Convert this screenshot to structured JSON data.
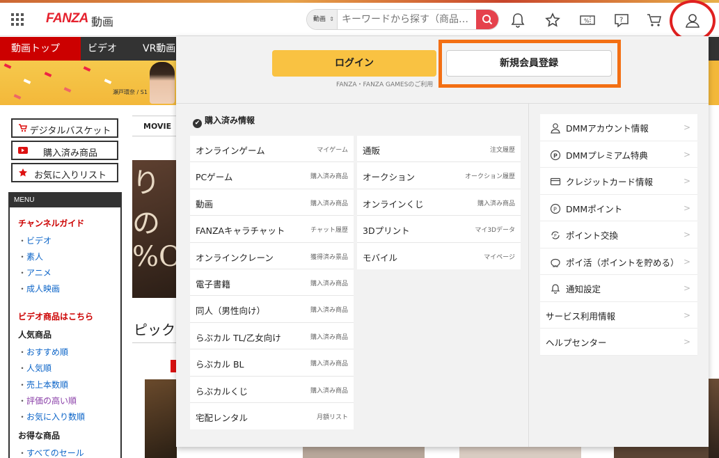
{
  "header": {
    "logo": "FANZA",
    "logo_sub": "動画",
    "search_category": "動画",
    "search_placeholder": "キーワードから探す（商品…",
    "icons": [
      "grid-menu-icon",
      "bell-icon",
      "star-icon",
      "coupon-icon",
      "help-icon",
      "cart-icon",
      "user-icon"
    ]
  },
  "nav": {
    "items": [
      "動画トップ",
      "ビデオ",
      "VR動画"
    ]
  },
  "banner": {
    "caption": "瀬戸環奈 / S1"
  },
  "sidebar": {
    "basket": "デジタルバスケット",
    "purchased": "購入済み商品",
    "favorites": "お気に入りリスト",
    "menu_title": "MENU",
    "channel_guide": "チャンネルガイド",
    "channel_links": [
      "ビデオ",
      "素人",
      "アニメ",
      "成人映画"
    ],
    "video_products": "ビデオ商品はこちら",
    "popular": "人気商品",
    "popular_links": [
      "おすすめ順",
      "人気順",
      "売上本数順",
      "評価の高い順",
      "お気に入り数順"
    ],
    "deals": "お得な商品",
    "deal_links": [
      "すべてのセール"
    ]
  },
  "background": {
    "tab_movie": "MOVIE",
    "promo_text": "りの %O",
    "pickup": "ピック"
  },
  "dropdown": {
    "login": "ログイン",
    "register": "新規会員登録",
    "login_note": "FANZA・FANZA GAMESのご利用",
    "purchase_info": "購入済み情報",
    "left_column": [
      {
        "label": "オンラインゲーム",
        "sub": "マイゲーム"
      },
      {
        "label": "PCゲーム",
        "sub": "購入済み商品"
      },
      {
        "label": "動画",
        "sub": "購入済み商品"
      },
      {
        "label": "FANZAキャラチャット",
        "sub": "チャット履歴"
      },
      {
        "label": "オンラインクレーン",
        "sub": "獲得済み景品"
      },
      {
        "label": "電子書籍",
        "sub": "購入済み商品"
      },
      {
        "label": "同人（男性向け）",
        "sub": "購入済み商品"
      },
      {
        "label": "らぶカル TL/乙女向け",
        "sub": "購入済み商品"
      },
      {
        "label": "らぶカル BL",
        "sub": "購入済み商品"
      },
      {
        "label": "らぶカルくじ",
        "sub": "購入済み商品"
      },
      {
        "label": "宅配レンタル",
        "sub": "月額リスト"
      }
    ],
    "right_column": [
      {
        "label": "通販",
        "sub": "注文履歴"
      },
      {
        "label": "オークション",
        "sub": "オークション履歴"
      },
      {
        "label": "オンラインくじ",
        "sub": "購入済み商品"
      },
      {
        "label": "3Dプリント",
        "sub": "マイ3Dデータ"
      },
      {
        "label": "モバイル",
        "sub": "マイページ"
      }
    ],
    "account_menu": [
      {
        "label": "DMMアカウント情報",
        "icon": "person-icon"
      },
      {
        "label": "DMMプレミアム特典",
        "icon": "premium-icon"
      },
      {
        "label": "クレジットカード情報",
        "icon": "credit-card-icon"
      },
      {
        "label": "DMMポイント",
        "icon": "point-icon"
      },
      {
        "label": "ポイント交換",
        "icon": "point-exchange-icon"
      },
      {
        "label": "ポイ活（ポイントを貯める）",
        "icon": "piggy-bank-icon"
      },
      {
        "label": "通知設定",
        "icon": "bell-icon"
      },
      {
        "label": "サービス利用情報",
        "icon": ""
      },
      {
        "label": "ヘルプセンター",
        "icon": ""
      }
    ]
  }
}
